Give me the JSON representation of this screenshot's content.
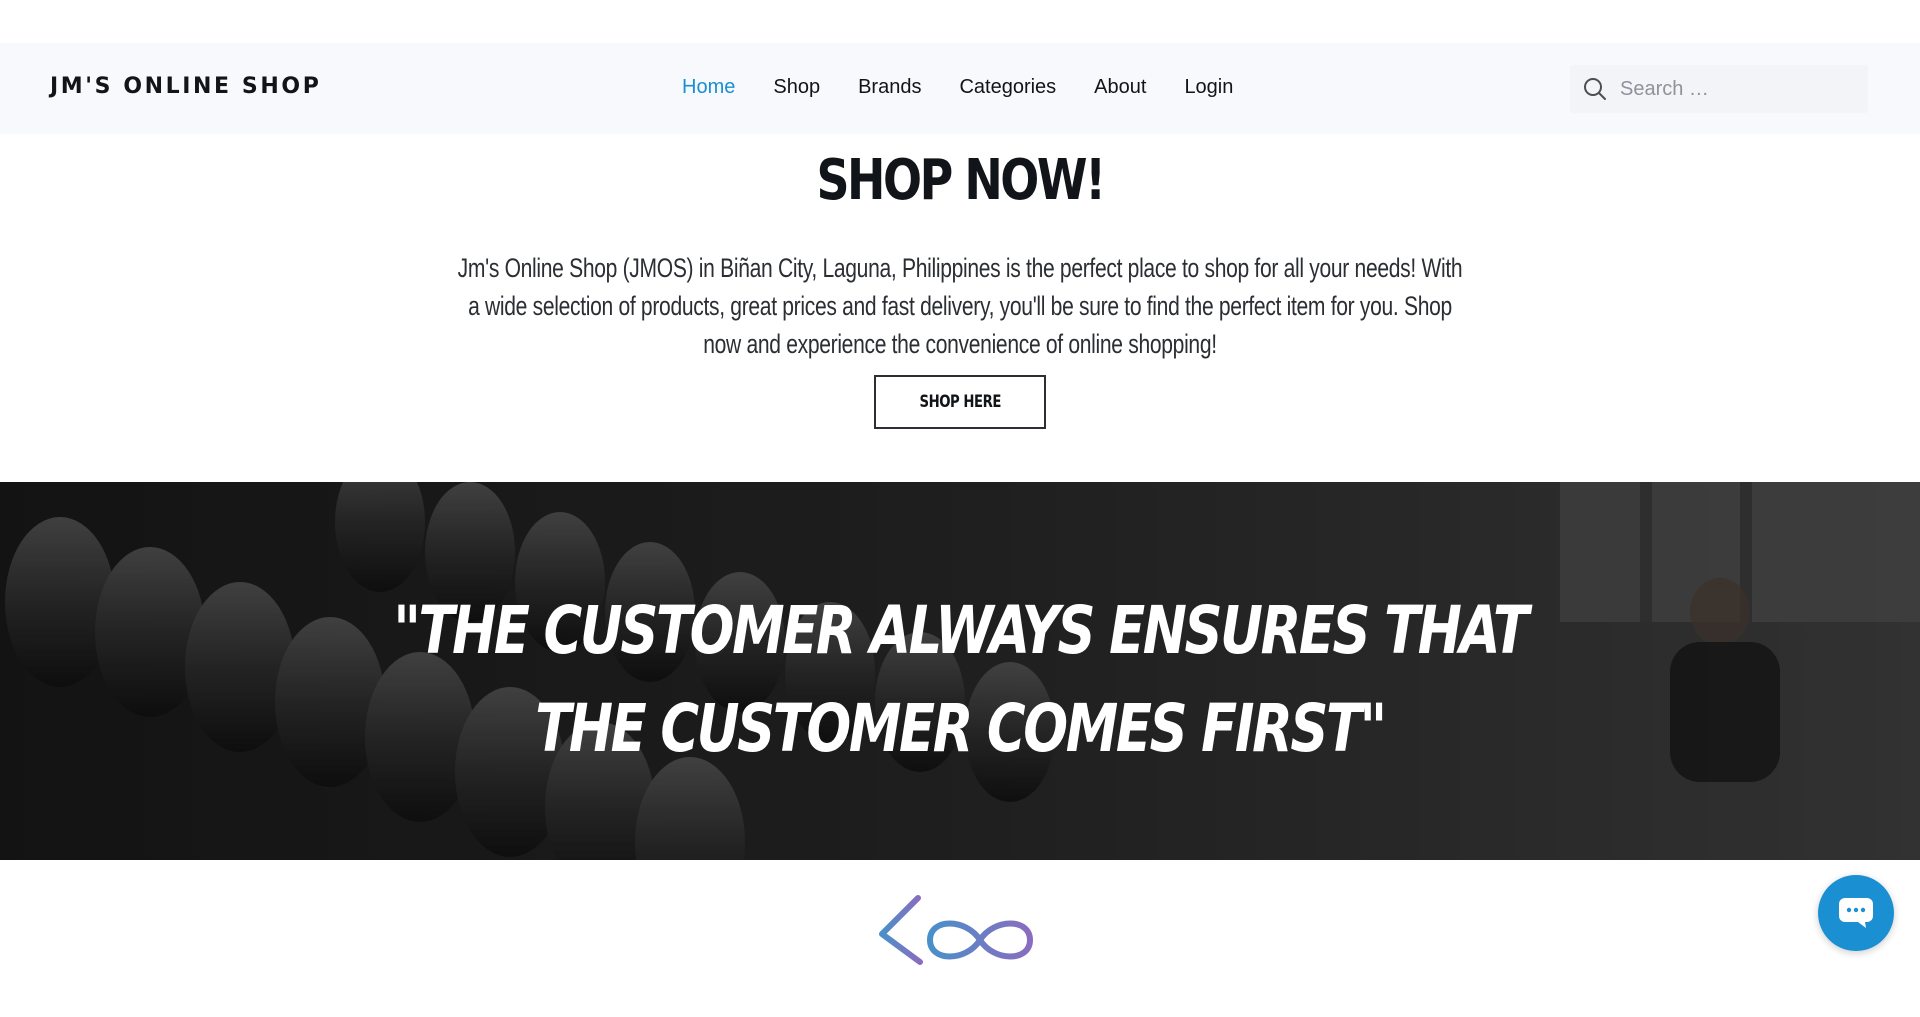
{
  "site": {
    "logo": "JM'S ONLINE SHOP"
  },
  "nav": {
    "items": [
      {
        "label": "Home",
        "active": true
      },
      {
        "label": "Shop",
        "active": false
      },
      {
        "label": "Brands",
        "active": false
      },
      {
        "label": "Categories",
        "active": false
      },
      {
        "label": "About",
        "active": false
      },
      {
        "label": "Login",
        "active": false
      }
    ]
  },
  "search": {
    "placeholder": "Search …",
    "value": ""
  },
  "hero": {
    "title": "SHOP NOW!",
    "description": "Jm's Online Shop (JMOS) in Biñan City, Laguna, Philippines is the perfect place to shop for all your needs! With a wide selection of products, great prices and fast delivery, you'll be sure to find the perfect item for you. Shop now and experience the convenience of online shopping!",
    "button_label": "SHOP HERE"
  },
  "banner": {
    "quote_line1": "\"THE CUSTOMER ALWAYS ENSURES THAT",
    "quote_line2": "THE CUSTOMER COMES FIRST\""
  },
  "brand": {
    "logo_text": "Kool"
  },
  "colors": {
    "accent": "#1a8fd1",
    "header_bg": "#f7f9fc",
    "text": "#111418",
    "logo_gradient_start": "#4a90c8",
    "logo_gradient_end": "#8a6cc0"
  },
  "icons": {
    "search": "search-icon",
    "chat": "chat-icon"
  }
}
